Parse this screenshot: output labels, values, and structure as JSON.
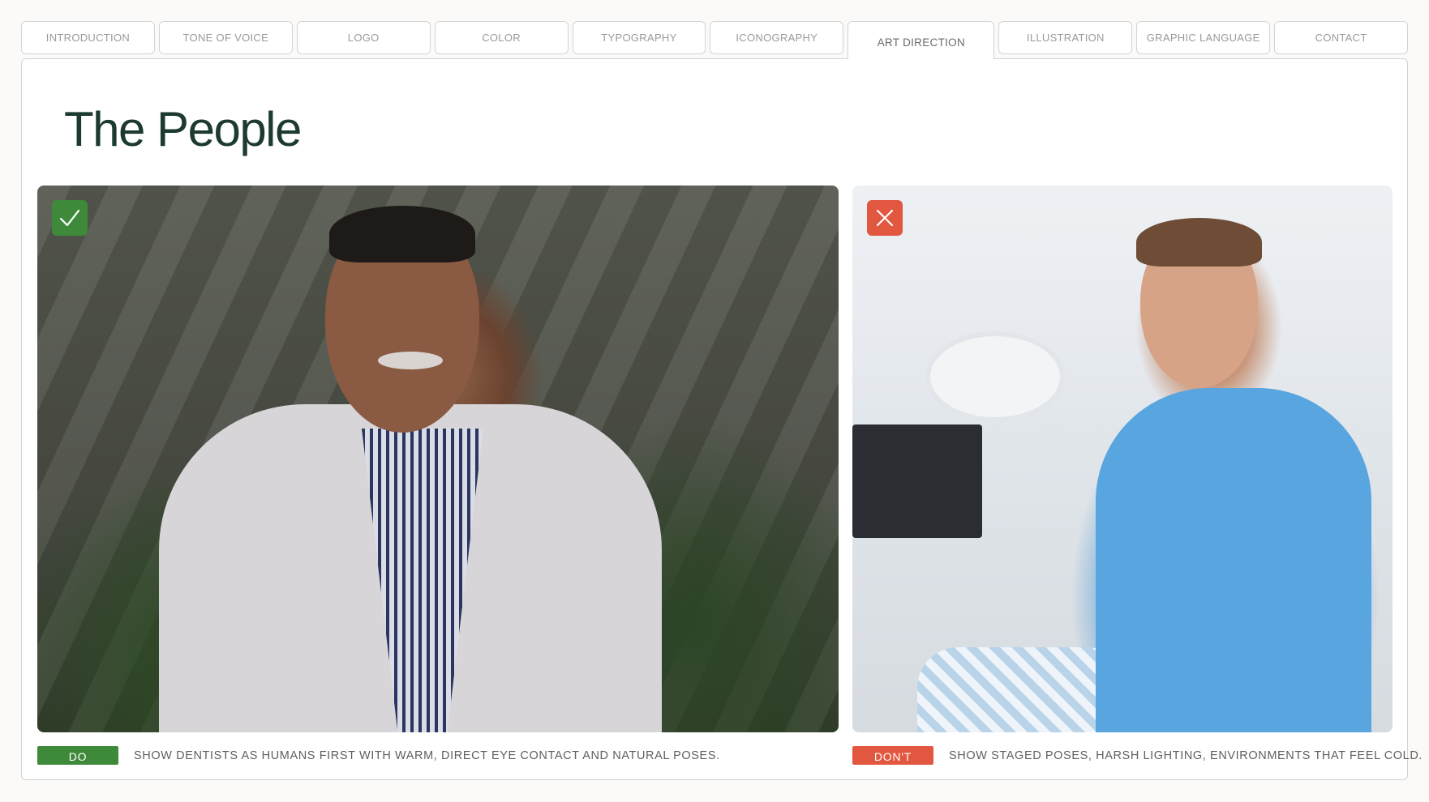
{
  "nav": {
    "tabs": [
      {
        "label": "INTRODUCTION"
      },
      {
        "label": "TONE OF VOICE"
      },
      {
        "label": "LOGO"
      },
      {
        "label": "COLOR"
      },
      {
        "label": "TYPOGRAPHY"
      },
      {
        "label": "ICONOGRAPHY"
      },
      {
        "label": "ART DIRECTION",
        "active": true
      },
      {
        "label": "ILLUSTRATION"
      },
      {
        "label": "GRAPHIC LANGUAGE"
      },
      {
        "label": "CONTACT"
      }
    ]
  },
  "page": {
    "title": "The People"
  },
  "examples": {
    "do": {
      "badge_icon": "checkmark-icon",
      "label": "DO",
      "caption": "SHOW DENTISTS AS HUMANS FIRST WITH WARM, DIRECT EYE CONTACT AND NATURAL POSES.",
      "color": "#3f8a3a"
    },
    "dont": {
      "badge_icon": "close-icon",
      "label": "DON'T",
      "caption": "SHOW STAGED POSES, HARSH LIGHTING, ENVIRONMENTS THAT FEEL COLD.",
      "color": "#e2573f"
    }
  },
  "colors": {
    "title": "#1d3a30",
    "tab_border": "#d4d4d4",
    "tab_text": "#9a9a9a",
    "background": "#fbfaf8"
  }
}
